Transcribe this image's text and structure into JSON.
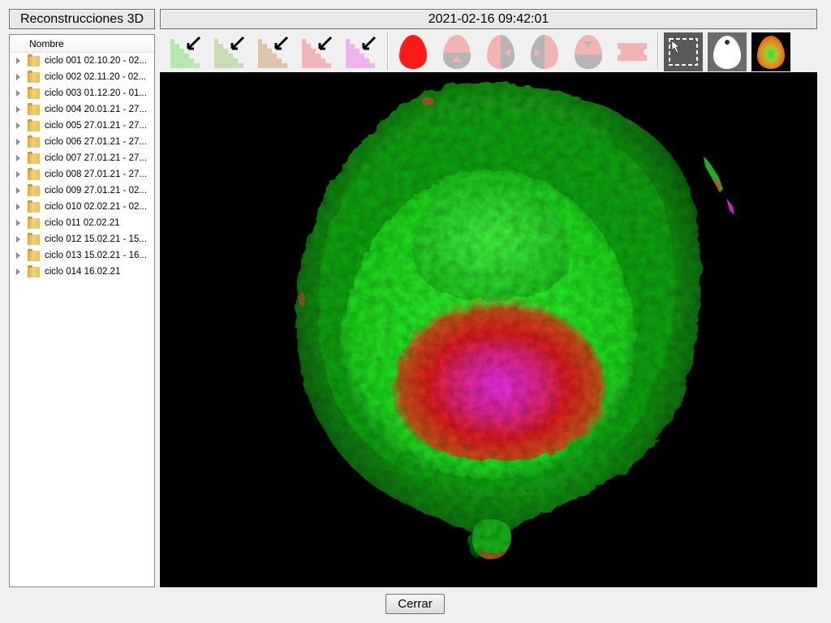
{
  "left_panel": {
    "title": "Reconstrucciones 3D",
    "column_header": "Nombre",
    "items": [
      {
        "label": "ciclo 001 02.10.20 - 02...."
      },
      {
        "label": "ciclo 002 02.11.20 - 02...."
      },
      {
        "label": "ciclo 003 01.12.20 - 01...."
      },
      {
        "label": "ciclo 004 20.01.21 - 27...."
      },
      {
        "label": "ciclo 005 27.01.21 - 27...."
      },
      {
        "label": "ciclo 006 27.01.21 - 27...."
      },
      {
        "label": "ciclo 007 27.01.21 - 27...."
      },
      {
        "label": "ciclo 008 27.01.21 - 27...."
      },
      {
        "label": "ciclo 009 27.01.21 - 02...."
      },
      {
        "label": "ciclo 010 02.02.21 - 02...."
      },
      {
        "label": "ciclo 011 02.02.21"
      },
      {
        "label": "ciclo 012 15.02.21 - 15...."
      },
      {
        "label": "ciclo 013 15.02.21 - 16...."
      },
      {
        "label": "ciclo 014 16.02.21"
      }
    ]
  },
  "header": {
    "timestamp": "2021-02-16 09:42:01"
  },
  "toolbar": {
    "buttons": [
      {
        "icon": "stairs-green-arrow-icon",
        "color": "#b7e6b0"
      },
      {
        "icon": "stairs-olive-arrow-icon",
        "color": "#c9dcb4"
      },
      {
        "icon": "stairs-tan-arrow-icon",
        "color": "#dec3ad"
      },
      {
        "icon": "stairs-pink-arrow-icon",
        "color": "#f1b7b7"
      },
      {
        "icon": "stairs-magenta-arrow-icon",
        "color": "#ecb6ec"
      },
      {
        "icon": "egg-red-icon",
        "color": "#ff1a1a"
      },
      {
        "icon": "egg-bottom-arrow-icon",
        "color": "#f2b3b3"
      },
      {
        "icon": "egg-left-arrow-icon",
        "color": "#f2b3b3"
      },
      {
        "icon": "egg-right-arrow-icon",
        "color": "#f2b3b3"
      },
      {
        "icon": "egg-top-arrow-icon",
        "color": "#f2b3b3"
      },
      {
        "icon": "ticket-icon",
        "color": "#f2b3b3"
      },
      {
        "icon": "selection-cursor-icon",
        "color": "#5a5a5a"
      },
      {
        "icon": "egg-white-icon",
        "color": "#6b6b6b"
      },
      {
        "icon": "egg-heatmap-icon",
        "color": "#000000"
      }
    ]
  },
  "footer": {
    "close_label": "Cerrar"
  }
}
